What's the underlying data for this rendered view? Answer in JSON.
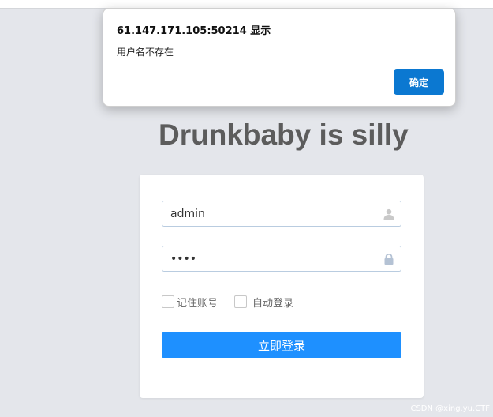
{
  "alert": {
    "title": "61.147.171.105:50214 显示",
    "message": "用户名不存在",
    "ok_label": "确定"
  },
  "page": {
    "heading": "Drunkbaby is silly"
  },
  "login": {
    "username_value": "admin",
    "password_value": "••••",
    "remember_label": "记住账号",
    "auto_login_label": "自动登录",
    "submit_label": "立即登录",
    "icons": {
      "username": "user-icon",
      "password": "lock-icon"
    }
  },
  "watermark": "CSDN @xing.yu.CTF",
  "colors": {
    "page_bg": "#e4e6eb",
    "primary_button": "#1e90ff",
    "dialog_button": "#0b78d1",
    "heading": "#5c5c5c"
  }
}
